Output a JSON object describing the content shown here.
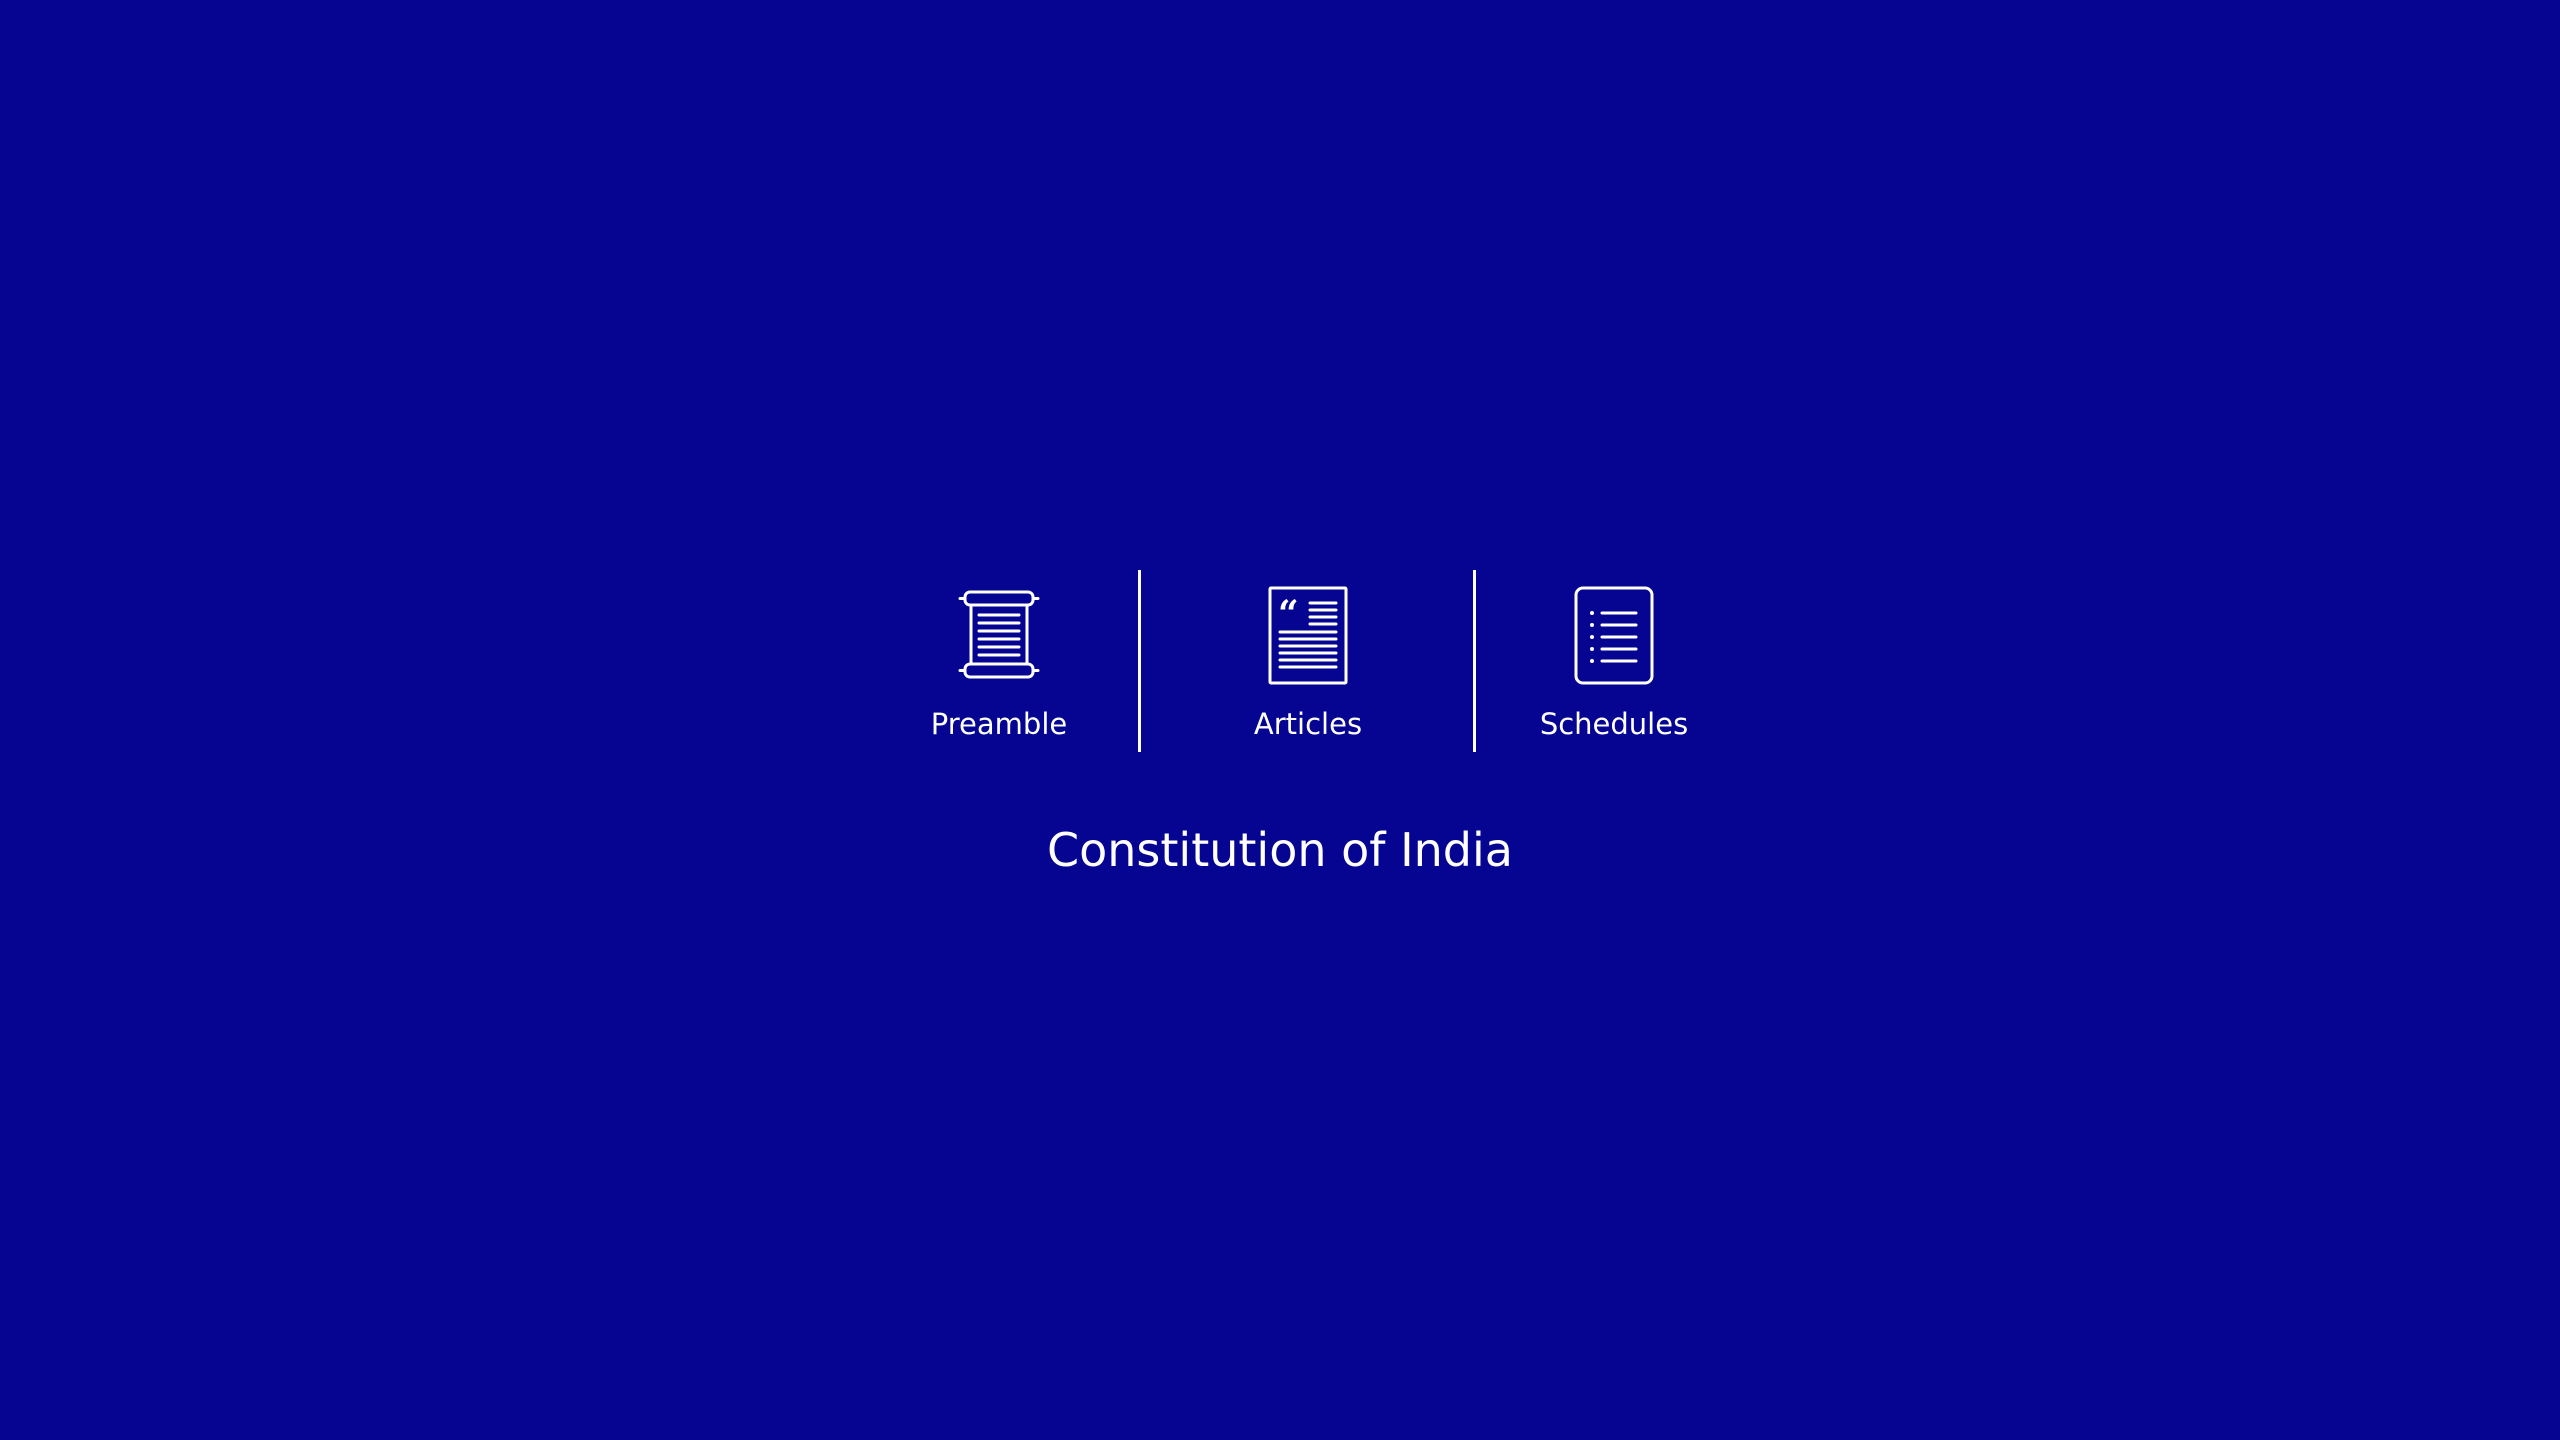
{
  "nav": {
    "items": [
      {
        "label": "Preamble",
        "icon": "scroll-icon"
      },
      {
        "label": "Articles",
        "icon": "quote-document-icon"
      },
      {
        "label": "Schedules",
        "icon": "list-document-icon"
      }
    ]
  },
  "title": "Constitution of India",
  "colors": {
    "background": "#050592",
    "foreground": "#ffffff"
  }
}
